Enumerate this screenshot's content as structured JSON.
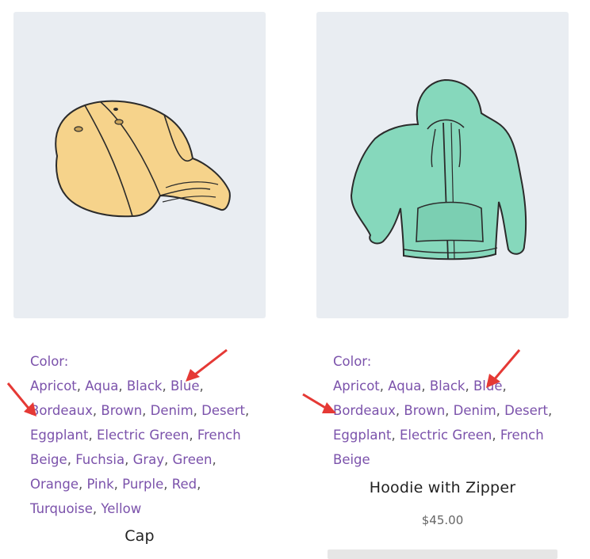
{
  "products": [
    {
      "name": "Cap",
      "image_icon": "cap-illustration",
      "attribute_label": "Color:",
      "colors": [
        "Apricot",
        "Aqua",
        "Black",
        "Blue",
        "Bordeaux",
        "Brown",
        "Denim",
        "Desert",
        "Eggplant",
        "Electric Green",
        "French Beige",
        "Fuchsia",
        "Gray",
        "Green",
        "Orange",
        "Pink",
        "Purple",
        "Red",
        "Turquoise",
        "Yellow"
      ]
    },
    {
      "name": "Hoodie with Zipper",
      "price": "$45.00",
      "image_icon": "hoodie-illustration",
      "attribute_label": "Color:",
      "colors": [
        "Apricot",
        "Aqua",
        "Black",
        "Blue",
        "Bordeaux",
        "Brown",
        "Denim",
        "Desert",
        "Eggplant",
        "Electric Green",
        "French Beige"
      ]
    }
  ],
  "annotations": {
    "arrow_color": "#e53935",
    "count": 4
  },
  "colors": {
    "link": "#7b52ab",
    "image_bg": "#e9edf2"
  }
}
